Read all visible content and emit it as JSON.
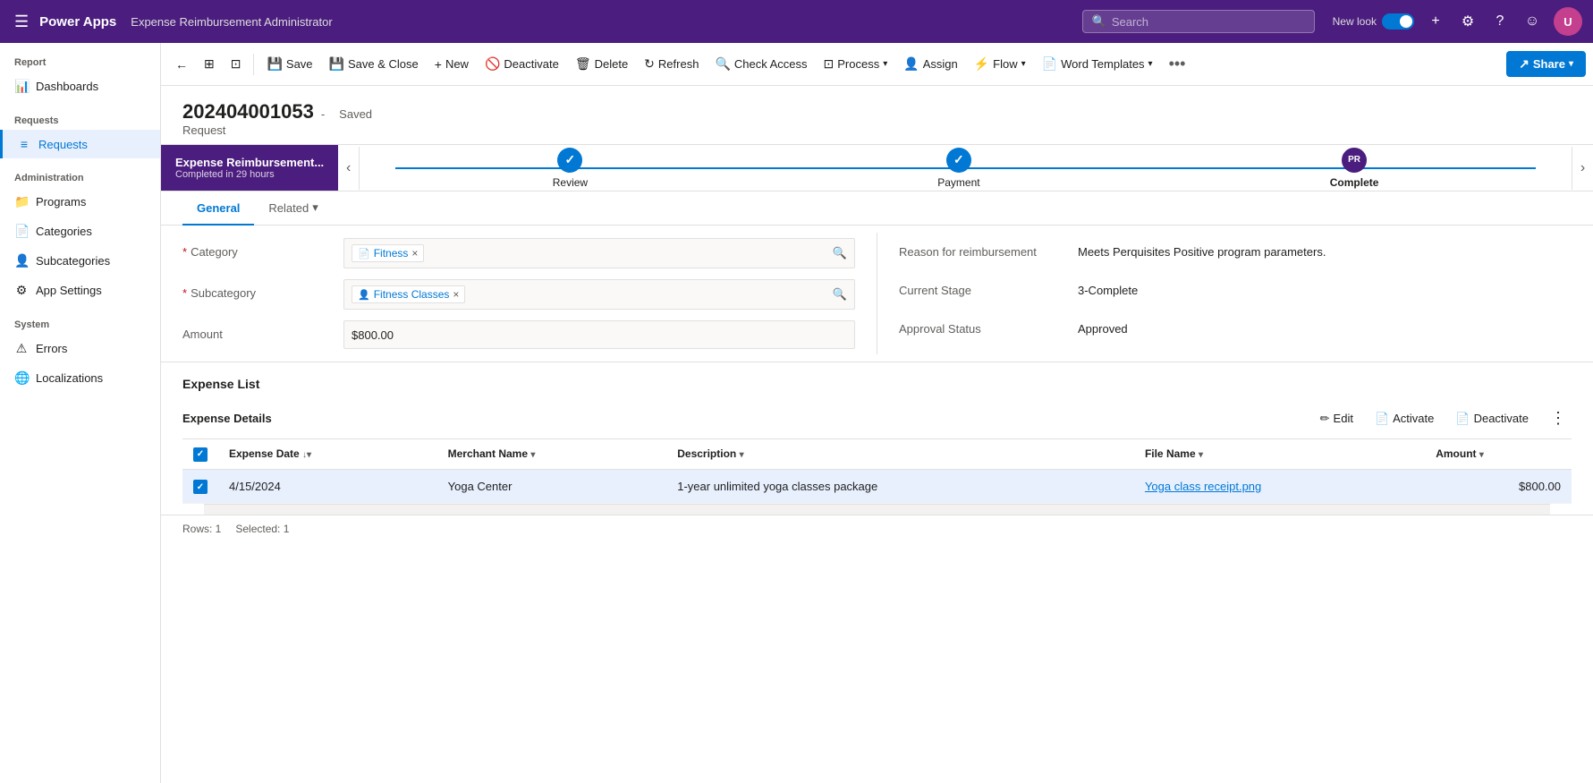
{
  "topNav": {
    "hamburger": "☰",
    "appName": "Power Apps",
    "appTitle": "Expense Reimbursement Administrator",
    "search": {
      "placeholder": "Search"
    },
    "newLook": "New look",
    "avatar": "U"
  },
  "toolbar": {
    "back": "←",
    "layout": "⊞",
    "popup": "⊡",
    "save": "Save",
    "saveClose": "Save & Close",
    "new": "New",
    "deactivate": "Deactivate",
    "delete": "Delete",
    "refresh": "Refresh",
    "checkAccess": "Check Access",
    "process": "Process",
    "assign": "Assign",
    "flow": "Flow",
    "wordTemplates": "Word Templates",
    "more": "•••",
    "share": "Share"
  },
  "record": {
    "id": "202404001053",
    "saved": "Saved",
    "type": "Request"
  },
  "stages": [
    {
      "label": "Review",
      "status": "complete",
      "icon": "✓"
    },
    {
      "label": "Payment",
      "status": "complete",
      "icon": "✓"
    },
    {
      "label": "Complete",
      "status": "current",
      "icon": "PR"
    }
  ],
  "activeStage": {
    "name": "Expense Reimbursement...",
    "sub": "Completed in 29 hours"
  },
  "tabs": [
    {
      "label": "General",
      "active": true
    },
    {
      "label": "Related",
      "hasDropdown": true
    }
  ],
  "form": {
    "left": [
      {
        "label": "Category",
        "required": true,
        "type": "tag",
        "tagIcon": "📄",
        "tagText": "Fitness",
        "hasSearch": true
      },
      {
        "label": "Subcategory",
        "required": true,
        "type": "tag",
        "tagIcon": "👤",
        "tagText": "Fitness Classes",
        "hasSearch": true
      },
      {
        "label": "Amount",
        "required": false,
        "type": "text",
        "value": "$800.00"
      }
    ],
    "right": [
      {
        "label": "Reason for reimbursement",
        "value": "Meets Perquisites Positive program parameters."
      },
      {
        "label": "Current Stage",
        "value": "3-Complete"
      },
      {
        "label": "Approval Status",
        "value": "Approved"
      }
    ]
  },
  "expenseList": {
    "sectionTitle": "Expense List",
    "detailsTitle": "Expense Details",
    "actions": {
      "edit": "Edit",
      "activate": "Activate",
      "deactivate": "Deactivate"
    },
    "columns": [
      {
        "label": "Expense Date",
        "sortable": true
      },
      {
        "label": "Merchant Name",
        "sortable": true
      },
      {
        "label": "Description",
        "sortable": true
      },
      {
        "label": "File Name",
        "sortable": true
      },
      {
        "label": "Amount",
        "sortable": true
      }
    ],
    "rows": [
      {
        "selected": true,
        "expenseDate": "4/15/2024",
        "merchantName": "Yoga Center",
        "description": "1-year unlimited yoga classes package",
        "fileName": "Yoga class receipt.png",
        "amount": "$800.00"
      }
    ],
    "footer": {
      "rows": "Rows: 1",
      "selected": "Selected: 1"
    }
  },
  "sidebar": {
    "sections": [
      {
        "label": "Report",
        "items": [
          {
            "id": "dashboards",
            "icon": "📊",
            "label": "Dashboards",
            "active": false
          }
        ]
      },
      {
        "label": "Requests",
        "items": [
          {
            "id": "requests",
            "icon": "≡",
            "label": "Requests",
            "active": true
          }
        ]
      },
      {
        "label": "Administration",
        "items": [
          {
            "id": "programs",
            "icon": "📁",
            "label": "Programs",
            "active": false
          },
          {
            "id": "categories",
            "icon": "📄",
            "label": "Categories",
            "active": false
          },
          {
            "id": "subcategories",
            "icon": "👤",
            "label": "Subcategories",
            "active": false
          },
          {
            "id": "app-settings",
            "icon": "⚙",
            "label": "App Settings",
            "active": false
          }
        ]
      },
      {
        "label": "System",
        "items": [
          {
            "id": "errors",
            "icon": "⚠",
            "label": "Errors",
            "active": false
          },
          {
            "id": "localizations",
            "icon": "🌐",
            "label": "Localizations",
            "active": false
          }
        ]
      }
    ]
  }
}
